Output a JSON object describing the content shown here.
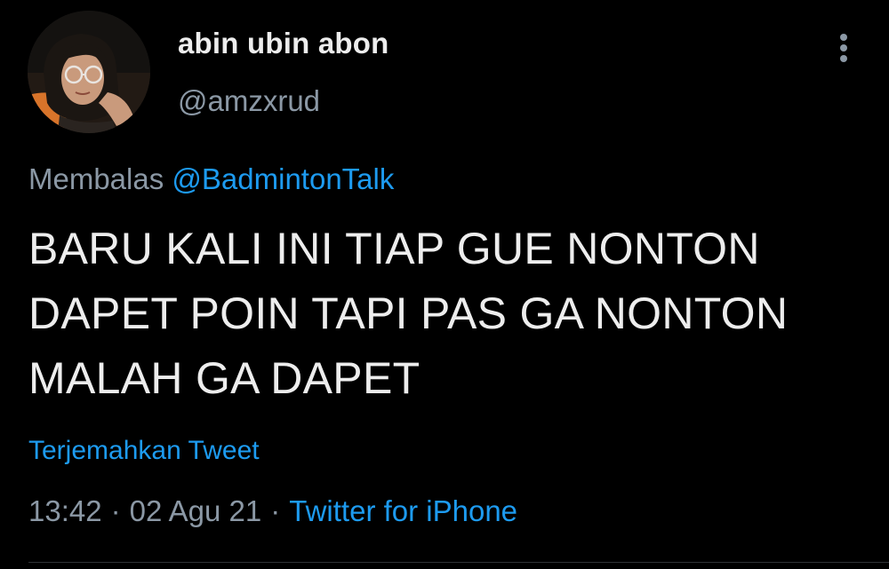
{
  "colors": {
    "background": "#000000",
    "text_primary": "#ededed",
    "text_secondary": "#8b98a5",
    "link": "#1d9bf0"
  },
  "author": {
    "display_name": "abin ubin abon",
    "handle": "@amzxrud",
    "avatar_icon": "profile-photo"
  },
  "more_icon": "vertical-ellipsis-icon",
  "reply": {
    "prefix": "Membalas",
    "mention": "@BadmintonTalk"
  },
  "tweet": {
    "lines": [
      "BARU KALI INI TIAP GUE NONTON",
      "DAPET POIN TAPI PAS GA NONTON",
      "MALAH GA DAPET"
    ]
  },
  "translate_label": "Terjemahkan Tweet",
  "meta": {
    "time": "13:42",
    "separator": "·",
    "date": "02 Agu 21",
    "source": "Twitter for iPhone"
  }
}
